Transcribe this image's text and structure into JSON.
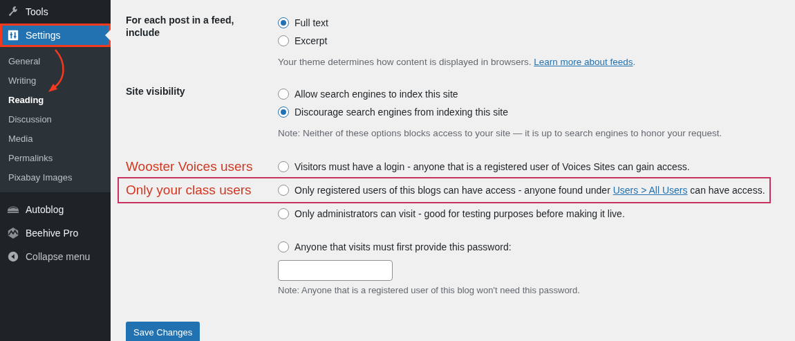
{
  "sidebar": {
    "items": [
      {
        "label": "Tools",
        "selected": false,
        "highlighted": false
      },
      {
        "label": "Settings",
        "selected": true,
        "highlighted": true,
        "children": [
          {
            "label": "General",
            "selected": false
          },
          {
            "label": "Writing",
            "selected": false
          },
          {
            "label": "Reading",
            "selected": true
          },
          {
            "label": "Discussion",
            "selected": false
          },
          {
            "label": "Media",
            "selected": false
          },
          {
            "label": "Permalinks",
            "selected": false
          },
          {
            "label": "Pixabay Images",
            "selected": false
          }
        ]
      },
      {
        "label": "Autoblog",
        "selected": false,
        "highlighted": false
      },
      {
        "label": "Beehive Pro",
        "selected": false,
        "highlighted": false
      },
      {
        "label": "Collapse menu",
        "selected": false,
        "highlighted": false
      }
    ]
  },
  "sections": [
    {
      "label": "For each post in a feed, include",
      "options": [
        {
          "label": "Full text",
          "selected": true
        },
        {
          "label": "Excerpt",
          "selected": false
        }
      ],
      "note": {
        "before": "Your theme determines how content is displayed in browsers. ",
        "link": "Learn more about feeds",
        "after": "."
      }
    },
    {
      "label": "Site visibility",
      "options": [
        {
          "label": "Allow search engines to index this site",
          "selected": false
        },
        {
          "label": "Discourage search engines from indexing this site",
          "selected": true
        }
      ],
      "note": {
        "before": "Note: Neither of these options blocks access to your site — it is up to search engines to honor your request."
      }
    }
  ],
  "privacy": {
    "options": [
      {
        "annotation": "Wooster Voices users",
        "label": "Visitors must have a login - anyone that is a registered user of Voices Sites can gain access.",
        "selected": false,
        "highlighted": false
      },
      {
        "annotation": "Only your class users",
        "label": "Only registered users of this blogs can have access - anyone found under ",
        "link": "Users > All Users",
        "after": " can have access.",
        "selected": false,
        "highlighted": true
      },
      {
        "label": "Only administrators can visit - good for testing purposes before making it live.",
        "selected": false,
        "highlighted": false
      },
      {
        "label": "Anyone that visits must first provide this password:",
        "selected": false,
        "highlighted": false
      }
    ],
    "password_note": "Note: Anyone that is a registered user of this blog won't need this password."
  },
  "button": "Save Changes"
}
